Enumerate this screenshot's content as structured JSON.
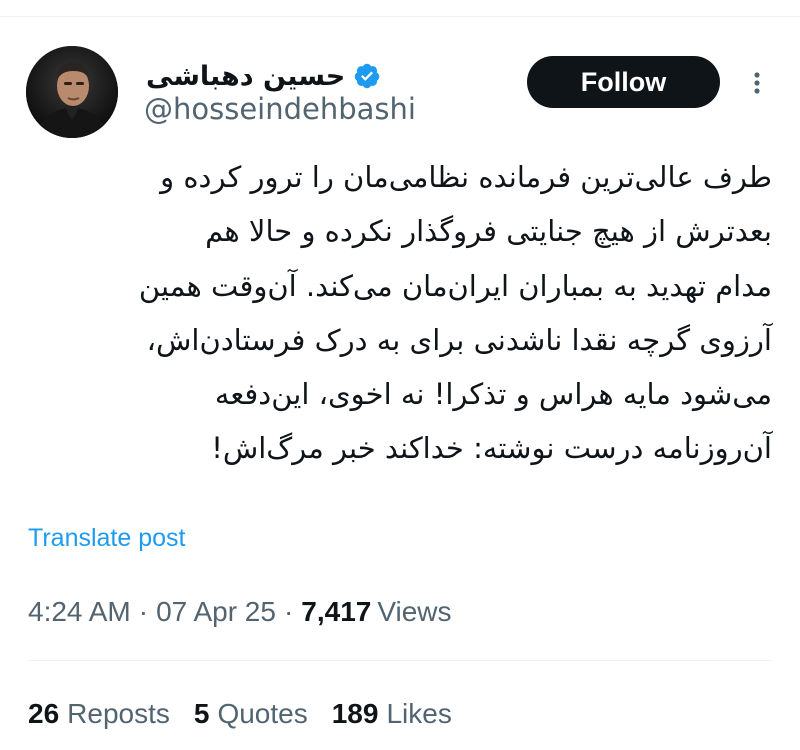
{
  "user": {
    "display_name": "حسین دهباشی",
    "handle": "@hosseindehbashi",
    "verified_icon": "verified-badge-icon"
  },
  "follow_label": "Follow",
  "colors": {
    "accent": "#1d9bf0",
    "text": "#0f1419",
    "secondary": "#536471",
    "button": "#0f1419"
  },
  "tweet": {
    "lines": [
      "طرف عالی‌ترین فرمانده نظامی‌مان را ترور کرده و",
      "بعدترش از هیچ جنایتی فروگذار نکرده و حالا هم",
      "مدام تهدید به بمباران ایران‌مان می‌کند. آن‌وقت همین",
      "آرزوی گرچه نقدا ناشدنی برای به درک فرستادن‌اش،",
      "می‌شود مایه هراس و تذکرا! نه اخوی، این‌دفعه",
      "آن‌روزنامه درست نوشته: خداکند خبر مرگ‌اش!"
    ]
  },
  "translate_label": "Translate post",
  "meta": {
    "time": "4:24 AM",
    "date": "07 Apr 25",
    "dot": "·",
    "views_count": "7,417",
    "views_label": "Views"
  },
  "stats": {
    "reposts_count": "26",
    "reposts_label": "Reposts",
    "quotes_count": "5",
    "quotes_label": "Quotes",
    "likes_count": "189",
    "likes_label": "Likes"
  }
}
